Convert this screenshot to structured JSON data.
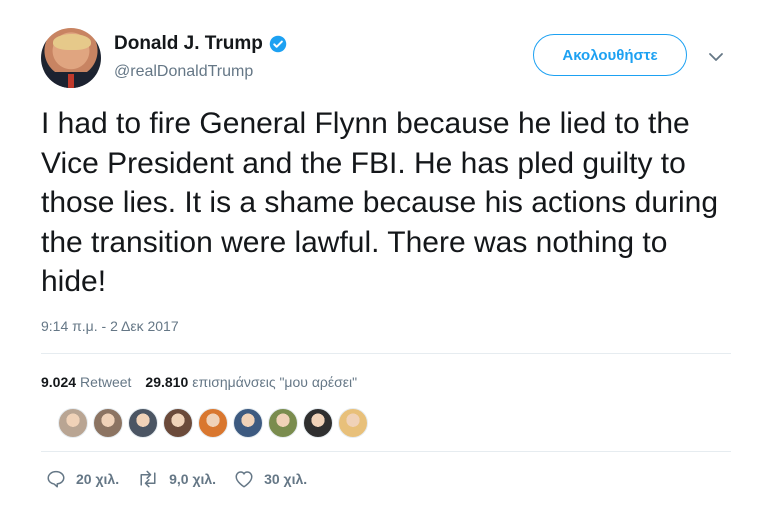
{
  "user": {
    "name": "Donald J. Trump",
    "handle": "@realDonaldTrump",
    "verified": true
  },
  "follow_button": {
    "label": "Ακολουθήστε"
  },
  "tweet": {
    "text": "I had to fire General Flynn because he lied to the Vice President and the FBI. He has pled guilty to those lies. It is a shame because his actions during the transition were lawful. There was nothing to hide!",
    "timestamp": "9:14 π.μ. - 2 Δεκ 2017"
  },
  "stats": {
    "retweets_count": "9.024",
    "retweets_label": "Retweet",
    "likes_count": "29.810",
    "likes_label": "επισημάνσεις \"μου αρέσει\""
  },
  "likers": [
    {
      "color": "#b9a593"
    },
    {
      "color": "#8c7462"
    },
    {
      "color": "#4b5563"
    },
    {
      "color": "#6b4a3a"
    },
    {
      "color": "#d9772f"
    },
    {
      "color": "#3d5a80"
    },
    {
      "color": "#7a8c4e"
    },
    {
      "color": "#2f2f2f"
    },
    {
      "color": "#e8c07a"
    }
  ],
  "actions": {
    "replies": "20 χιλ.",
    "retweets": "9,0 χιλ.",
    "likes": "30 χιλ."
  },
  "colors": {
    "accent": "#1da1f2",
    "muted": "#657786",
    "text": "#14171a"
  }
}
